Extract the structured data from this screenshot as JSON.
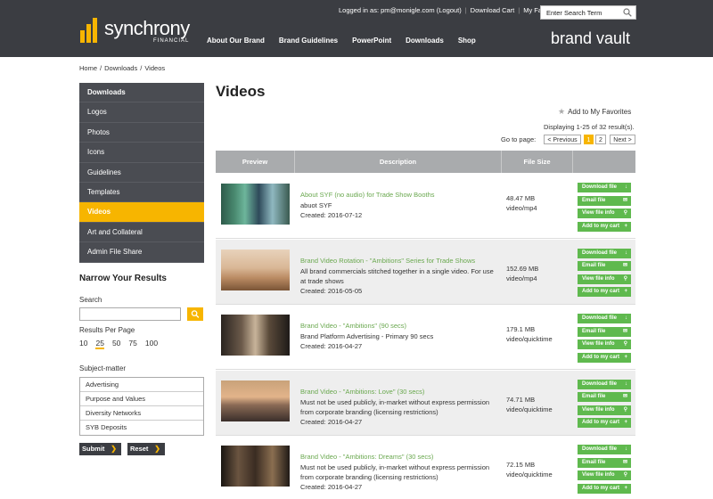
{
  "header": {
    "logo_text": "synchrony",
    "logo_sub": "FINANCIAL",
    "logged_in": "Logged in as: pm@monigle.com (Logout)",
    "download_cart": "Download Cart",
    "my_favorites": "My Favorites",
    "search_placeholder": "Enter Search Term",
    "brand_vault": "brand vault",
    "nav": [
      "About Our Brand",
      "Brand Guidelines",
      "PowerPoint",
      "Downloads",
      "Shop"
    ]
  },
  "breadcrumb": [
    "Home",
    "Downloads",
    "Videos"
  ],
  "sidebar": {
    "items": [
      {
        "label": "Downloads",
        "bold": true
      },
      {
        "label": "Logos"
      },
      {
        "label": "Photos"
      },
      {
        "label": "Icons"
      },
      {
        "label": "Guidelines"
      },
      {
        "label": "Templates"
      },
      {
        "label": "Videos",
        "active": true
      },
      {
        "label": "Art and Collateral"
      },
      {
        "label": "Admin File Share"
      }
    ],
    "narrow_title": "Narrow Your Results",
    "search_label": "Search",
    "rpp_label": "Results Per Page",
    "rpp_options": [
      "10",
      "25",
      "50",
      "75",
      "100"
    ],
    "rpp_selected": "25",
    "subject_label": "Subject-matter",
    "subjects": [
      "Advertising",
      "Purpose and Values",
      "Diversity Networks",
      "SYB Deposits"
    ],
    "submit": "Submit",
    "reset": "Reset"
  },
  "main": {
    "title": "Videos",
    "add_fav": "Add to My Favorites",
    "displaying": "Displaying 1-25 of 32 result(s).",
    "goto": "Go to page:",
    "prev": "< Previous",
    "pages": [
      "1",
      "2"
    ],
    "current_page": "1",
    "next": "Next >",
    "columns": [
      "Preview",
      "Description",
      "File Size",
      ""
    ],
    "actions": [
      "Download file",
      "Email file",
      "View file info",
      "Add to my cart"
    ],
    "action_icons": [
      "↓",
      "✉",
      "⚲",
      "+"
    ],
    "rows": [
      {
        "title": "About SYF (no audio) for Trade Show Booths",
        "desc": "abuot SYF",
        "created": "Created: 2016-07-12",
        "size": "48.47 MB",
        "type": "video/mp4"
      },
      {
        "title": "Brand Video Rotation - \"Ambitions\" Series for Trade Shows",
        "desc": "All brand commercials stitched together in a single video. For use at trade shows",
        "created": "Created: 2016-05-05",
        "size": "152.69 MB",
        "type": "video/mp4"
      },
      {
        "title": "Brand Video - \"Ambitions\" (90 secs)",
        "desc": "Brand Platform Advertising - Primary 90 secs",
        "created": "Created: 2016-04-27",
        "size": "179.1 MB",
        "type": "video/quicktime"
      },
      {
        "title": "Brand Video - \"Ambitions: Love\" (30 secs)",
        "desc": "Must not be used publicly, in-market without express permission from corporate branding (licensing restrictions)",
        "created": "Created: 2016-04-27",
        "size": "74.71 MB",
        "type": "video/quicktime"
      },
      {
        "title": "Brand Video - \"Ambitions: Dreams\" (30 secs)",
        "desc": "Must not be used publicly, in-market without express permission from corporate branding (licensing restrictions)",
        "created": "Created: 2016-04-27",
        "size": "72.15 MB",
        "type": "video/quicktime"
      }
    ]
  },
  "colors": {
    "header": "#3b3d42",
    "accent": "#f7b500",
    "green": "#5fb94e",
    "link": "#6aa84f"
  }
}
